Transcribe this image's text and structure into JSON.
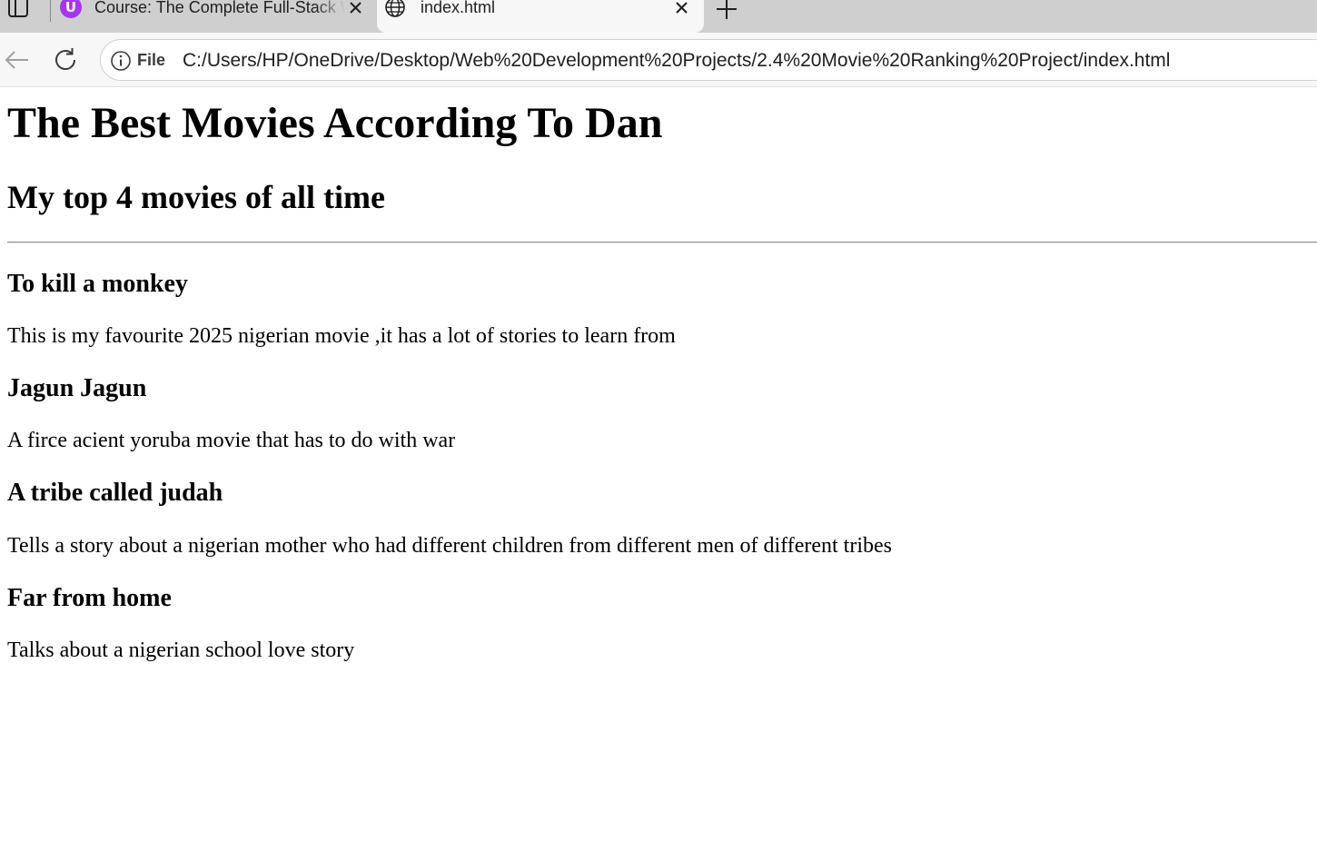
{
  "browser": {
    "tabs": [
      {
        "title": "Course: The Complete Full-Stack Web",
        "favicon": "udemy-icon",
        "active": false
      },
      {
        "title": "index.html",
        "favicon": "globe-icon",
        "active": true
      }
    ],
    "address_bar": {
      "scheme_label": "File",
      "url": "C:/Users/HP/OneDrive/Desktop/Web%20Development%20Projects/2.4%20Movie%20Ranking%20Project/index.html"
    }
  },
  "page": {
    "heading": "The Best Movies According To Dan",
    "subheading": "My top 4 movies of all time",
    "movies": [
      {
        "title": "To kill a monkey",
        "description": "This is my favourite 2025 nigerian movie ,it has a lot of stories to learn from"
      },
      {
        "title": "Jagun Jagun",
        "description": "A firce acient yoruba movie that has to do with war"
      },
      {
        "title": "A tribe called judah",
        "description": "Tells a story about a nigerian mother who had different children from different men of different tribes"
      },
      {
        "title": "Far from home",
        "description": "Talks about a nigerian school love story"
      }
    ]
  }
}
